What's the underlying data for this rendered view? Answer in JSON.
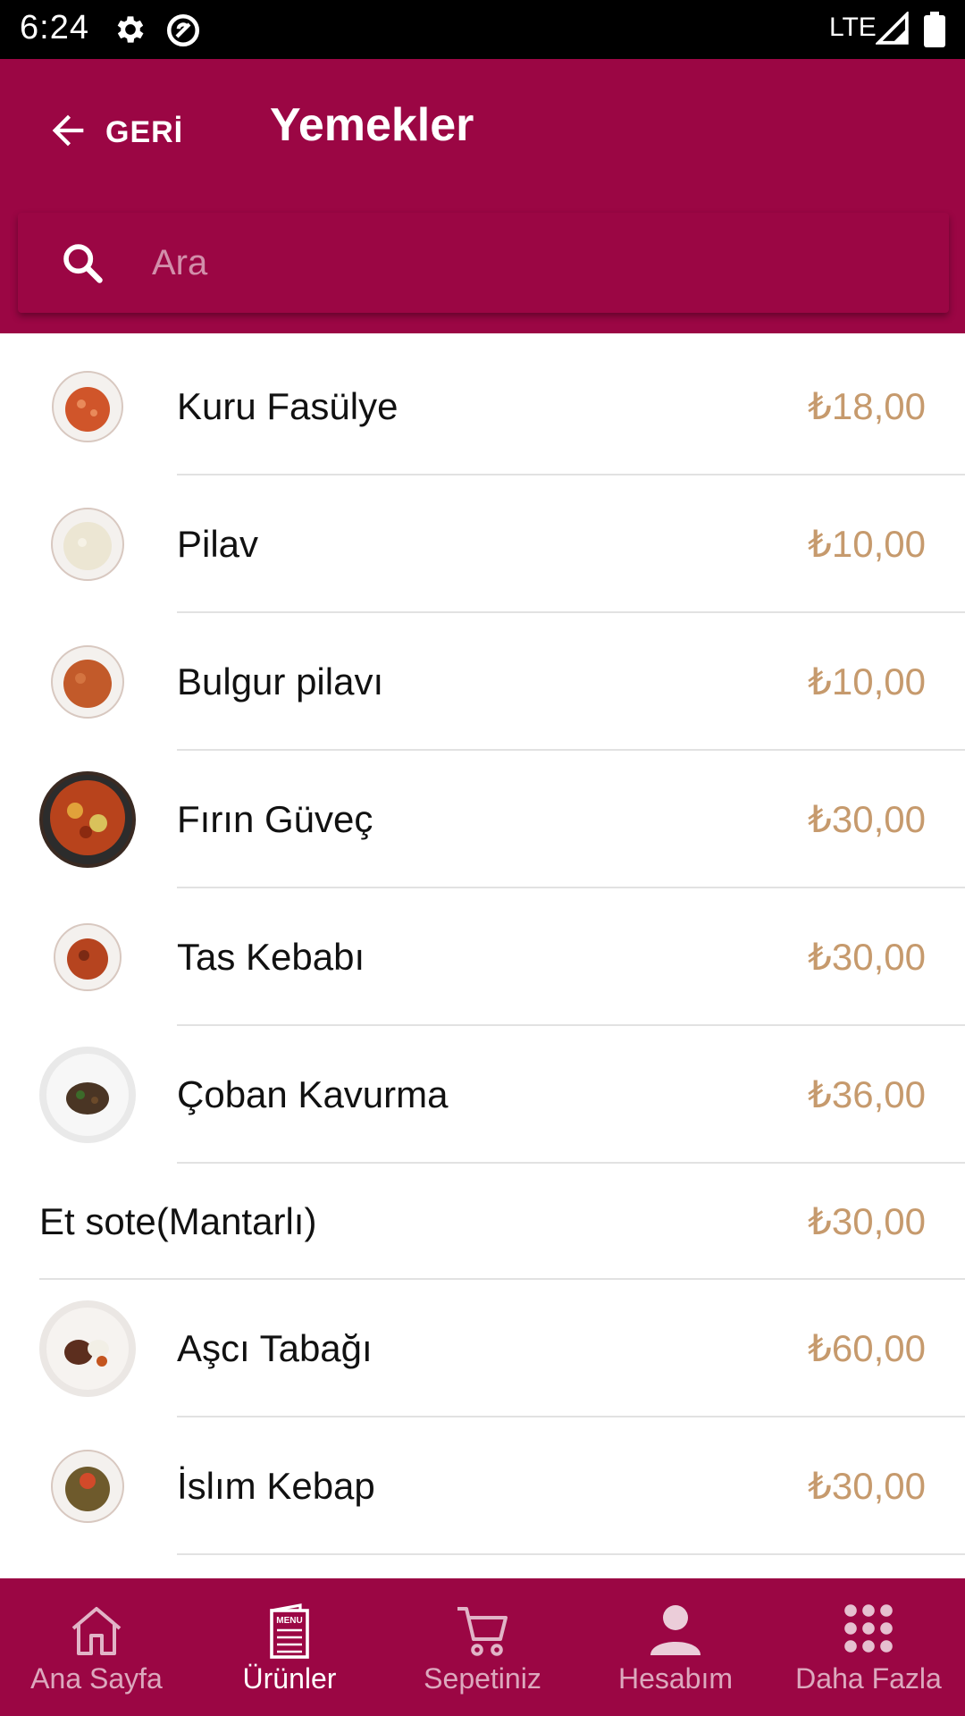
{
  "status_bar": {
    "time": "6:24",
    "network": "LTE"
  },
  "header": {
    "back_label": "GERİ",
    "title": "Yemekler"
  },
  "search": {
    "placeholder": "Ara",
    "value": ""
  },
  "items": [
    {
      "name": "Kuru Fasülye",
      "price": "₺18,00"
    },
    {
      "name": "Pilav",
      "price": "₺10,00"
    },
    {
      "name": "Bulgur pilavı",
      "price": "₺10,00"
    },
    {
      "name": "Fırın Güveç",
      "price": "₺30,00"
    },
    {
      "name": "Tas Kebabı",
      "price": "₺30,00"
    },
    {
      "name": "Çoban Kavurma",
      "price": "₺36,00"
    },
    {
      "name": "Et sote(Mantarlı)",
      "price": "₺30,00"
    },
    {
      "name": "Aşcı Tabağı",
      "price": "₺60,00"
    },
    {
      "name": "İslım Kebap",
      "price": "₺30,00"
    }
  ],
  "bottom_nav": [
    {
      "label": "Ana Sayfa",
      "icon": "home-icon"
    },
    {
      "label": "Ürünler",
      "icon": "menu-icon",
      "active": true
    },
    {
      "label": "Sepetiniz",
      "icon": "cart-icon"
    },
    {
      "label": "Hesabım",
      "icon": "person-icon"
    },
    {
      "label": "Daha Fazla",
      "icon": "grid-icon"
    }
  ],
  "colors": {
    "primary": "#9b0644",
    "price": "#c69a6d",
    "divider": "#e2e2e2",
    "statusbar": "#000000"
  }
}
